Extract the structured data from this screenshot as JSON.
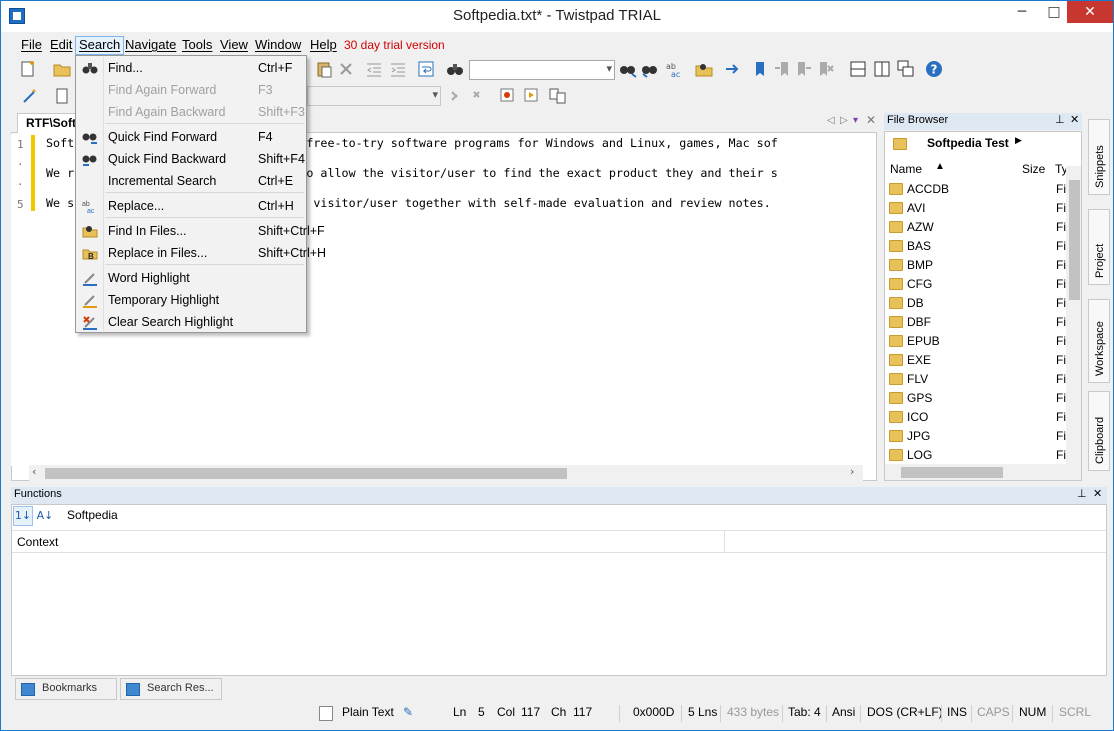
{
  "window": {
    "title": "Softpedia.txt* - Twistpad TRIAL",
    "minimize": "─",
    "maximize": "□",
    "close": "✕"
  },
  "menubar": {
    "items": [
      "File",
      "Edit",
      "Search",
      "Navigate",
      "Tools",
      "View",
      "Window",
      "Help"
    ],
    "trial": "30 day trial version"
  },
  "editor": {
    "tab_label": "RTF\\Soft",
    "gutter_numbers": [
      "1",
      "·",
      "·",
      "5"
    ],
    "lines": [
      "Soft                    000 free and free-to-try software programs for Windows and Linux, games, Mac sof",
      "We r                    ts in order to allow the visitor/user to find the exact product they and their s",
      "We s                    oducts to the visitor/user together with self-made evaluation and review notes."
    ]
  },
  "search_menu": {
    "items": [
      {
        "label": "Find...",
        "shortcut": "Ctrl+F",
        "disabled": false,
        "icon": "binoculars-icon"
      },
      {
        "label": "Find Again Forward",
        "shortcut": "F3",
        "disabled": true,
        "icon": ""
      },
      {
        "label": "Find Again Backward",
        "shortcut": "Shift+F3",
        "disabled": true,
        "icon": ""
      },
      {
        "label": "Quick Find Forward",
        "shortcut": "F4",
        "disabled": false,
        "icon": "quick-find-forward-icon"
      },
      {
        "label": "Quick Find Backward",
        "shortcut": "Shift+F4",
        "disabled": false,
        "icon": "quick-find-backward-icon"
      },
      {
        "label": "Incremental Search",
        "shortcut": "Ctrl+E",
        "disabled": false,
        "icon": ""
      },
      {
        "label": "Replace...",
        "shortcut": "Ctrl+H",
        "disabled": false,
        "icon": "replace-icon"
      },
      {
        "label": "Find In Files...",
        "shortcut": "Shift+Ctrl+F",
        "disabled": false,
        "icon": "find-in-files-icon"
      },
      {
        "label": "Replace in Files...",
        "shortcut": "Shift+Ctrl+H",
        "disabled": false,
        "icon": "replace-in-files-icon"
      },
      {
        "label": "Word Highlight",
        "shortcut": "",
        "disabled": false,
        "icon": "word-highlight-icon"
      },
      {
        "label": "Temporary Highlight",
        "shortcut": "",
        "disabled": false,
        "icon": "temporary-highlight-icon"
      },
      {
        "label": "Clear Search Highlight",
        "shortcut": "",
        "disabled": false,
        "icon": "clear-highlight-icon"
      }
    ]
  },
  "file_browser": {
    "title": "File Browser",
    "path": "Softpedia Test",
    "columns": [
      "Name",
      "Size",
      "Ty"
    ],
    "rows": [
      {
        "name": "ACCDB",
        "type": "Fil"
      },
      {
        "name": "AVI",
        "type": "Fil"
      },
      {
        "name": "AZW",
        "type": "Fil"
      },
      {
        "name": "BAS",
        "type": "Fil"
      },
      {
        "name": "BMP",
        "type": "Fil"
      },
      {
        "name": "CFG",
        "type": "Fil"
      },
      {
        "name": "DB",
        "type": "Fil"
      },
      {
        "name": "DBF",
        "type": "Fil"
      },
      {
        "name": "EPUB",
        "type": "Fil"
      },
      {
        "name": "EXE",
        "type": "Fil"
      },
      {
        "name": "FLV",
        "type": "Fil"
      },
      {
        "name": "GPS",
        "type": "Fil"
      },
      {
        "name": "ICO",
        "type": "Fil"
      },
      {
        "name": "JPG",
        "type": "Fil"
      },
      {
        "name": "LOG",
        "type": "Fil"
      }
    ]
  },
  "side_tabs": [
    "Snippets",
    "Project",
    "Workspace",
    "Clipboard"
  ],
  "functions": {
    "title": "Functions",
    "filter": "Softpedia",
    "context_header": "Context"
  },
  "bottom_tabs": [
    "Bookmarks",
    "Search Res..."
  ],
  "status": {
    "mode": "Plain Text",
    "ln_label": "Ln",
    "ln": "5",
    "col_label": "Col",
    "col": "117",
    "ch_label": "Ch",
    "ch": "117",
    "char_code": "0x000D",
    "lines": "5 Lns",
    "size": "433 bytes",
    "tab": "Tab: 4",
    "encoding": "Ansi",
    "eol": "DOS (CR+LF)",
    "ins": "INS",
    "caps": "CAPS",
    "num": "NUM",
    "scrl": "SCRL"
  },
  "colors": {
    "accent": "#1979ca",
    "trial": "#d40000",
    "close_btn": "#c7372f",
    "marker": "#f0c800",
    "panel_title": "#dde8f3"
  }
}
